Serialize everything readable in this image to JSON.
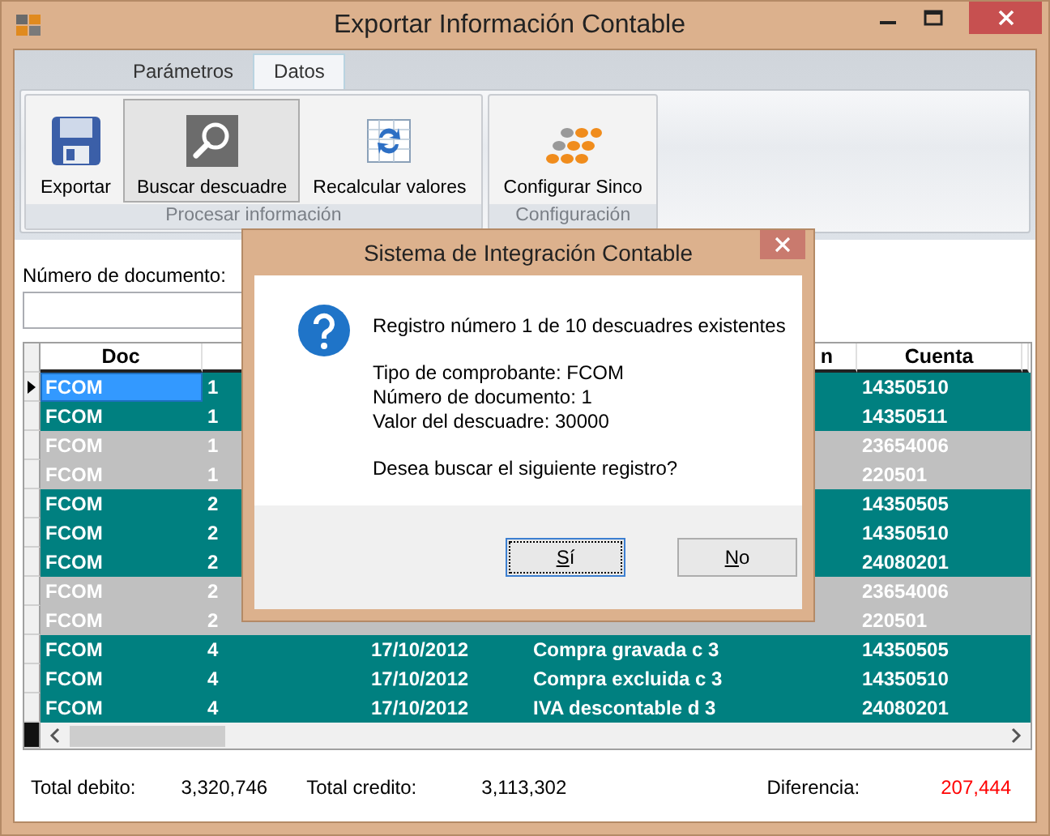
{
  "window": {
    "title": "Exportar Información Contable"
  },
  "tabs": [
    {
      "label": "Parámetros",
      "selected": false
    },
    {
      "label": "Datos",
      "selected": true
    }
  ],
  "ribbon_groups": [
    {
      "label": "Procesar información",
      "buttons": [
        {
          "label": "Exportar",
          "kind": "floppy",
          "selected": false
        },
        {
          "label": "Buscar descuadre",
          "kind": "search",
          "selected": true
        },
        {
          "label": "Recalcular valores",
          "kind": "recalc",
          "selected": false
        }
      ]
    },
    {
      "label": "Configuración",
      "buttons": [
        {
          "label": "Configurar Sinco",
          "kind": "dots",
          "selected": false
        }
      ]
    }
  ],
  "document_field": {
    "label": "Número de documento:"
  },
  "table": {
    "headers": {
      "column_1": "Doc",
      "column_4": "n",
      "column_5": "Cuenta"
    },
    "rows": [
      {
        "doc": "FCOM",
        "number": "1",
        "account": "14350510",
        "color": "#008080",
        "selected": true
      },
      {
        "doc": "FCOM",
        "number": "1",
        "account": "14350511",
        "color": "#008080",
        "selected": false
      },
      {
        "doc": "FCOM",
        "number": "1",
        "account": "23654006",
        "color": "#c0c0c0",
        "selected": false
      },
      {
        "doc": "FCOM",
        "number": "1",
        "account": "220501",
        "color": "#c0c0c0",
        "selected": false
      },
      {
        "doc": "FCOM",
        "number": "2",
        "account": "14350505",
        "color": "#008080",
        "selected": false
      },
      {
        "doc": "FCOM",
        "number": "2",
        "account": "14350510",
        "color": "#008080",
        "selected": false
      },
      {
        "doc": "FCOM",
        "number": "2",
        "account": "24080201",
        "color": "#008080",
        "selected": false
      },
      {
        "doc": "FCOM",
        "number": "2",
        "account": "23654006",
        "color": "#c0c0c0",
        "selected": false
      },
      {
        "doc": "FCOM",
        "number": "2",
        "account": "220501",
        "color": "#c0c0c0",
        "selected": false
      },
      {
        "doc": "FCOM",
        "number": "4",
        "date": "17/10/2012",
        "description": "Compra gravada c 3",
        "account": "14350505",
        "color": "#008080",
        "selected": false
      },
      {
        "doc": "FCOM",
        "number": "4",
        "date": "17/10/2012",
        "description": "Compra excluida c 3",
        "account": "14350510",
        "color": "#008080",
        "selected": false
      },
      {
        "doc": "FCOM",
        "number": "4",
        "date": "17/10/2012",
        "description": "IVA descontable d 3",
        "account": "24080201",
        "color": "#008080",
        "selected": false
      }
    ]
  },
  "totals": [
    {
      "label": "Total debito:",
      "value": "3,320,746",
      "color": "#000000"
    },
    {
      "label": "Total credito:",
      "value": "3,113,302",
      "color": "#000000"
    },
    {
      "label": "Diferencia:",
      "value": "207,444",
      "color": "#ff0000"
    }
  ],
  "dialog": {
    "title": "Sistema de Integración Contable",
    "lines": [
      "Registro número 1 de 10 descuadres existentes",
      "Tipo de comprobante: FCOM",
      "Número de documento: 1",
      "Valor del descuadre: 30000",
      "Desea buscar el siguiente registro?"
    ],
    "buttons": [
      {
        "label": "Sí",
        "selected": true
      },
      {
        "label": "No",
        "selected": false
      }
    ]
  }
}
